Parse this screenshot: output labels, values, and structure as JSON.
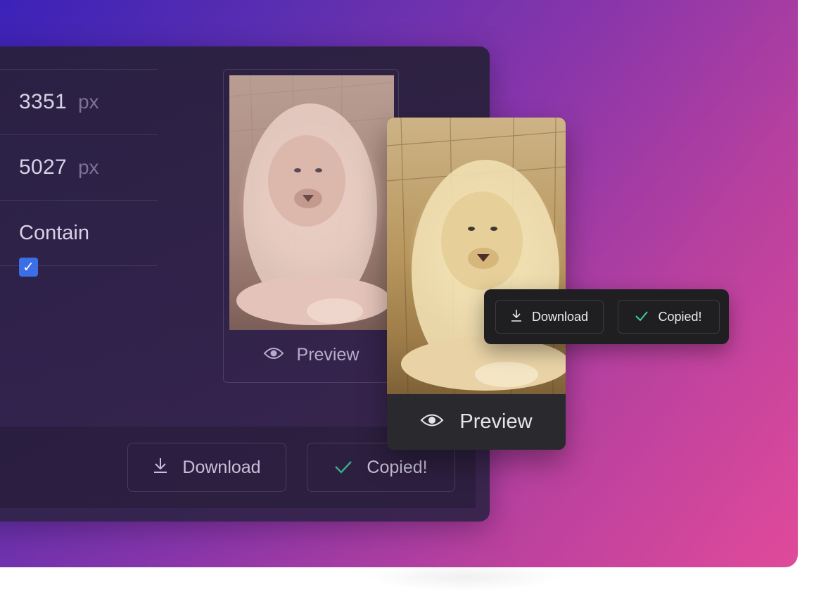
{
  "settings": {
    "width": {
      "value": "3351",
      "unit": "px"
    },
    "height": {
      "value": "5027",
      "unit": "px"
    },
    "fit": "Contain",
    "checkbox_checked": true
  },
  "preview": {
    "label": "Preview"
  },
  "actions": {
    "download_label": "Download",
    "copied_label": "Copied!"
  },
  "icons": {
    "eye": "eye-icon",
    "download": "download-icon",
    "check": "check-icon",
    "checkbox": "checkbox-checked-icon"
  },
  "colors": {
    "accent_check": "#3fcf9b",
    "checkbox": "#3b6fe8"
  }
}
